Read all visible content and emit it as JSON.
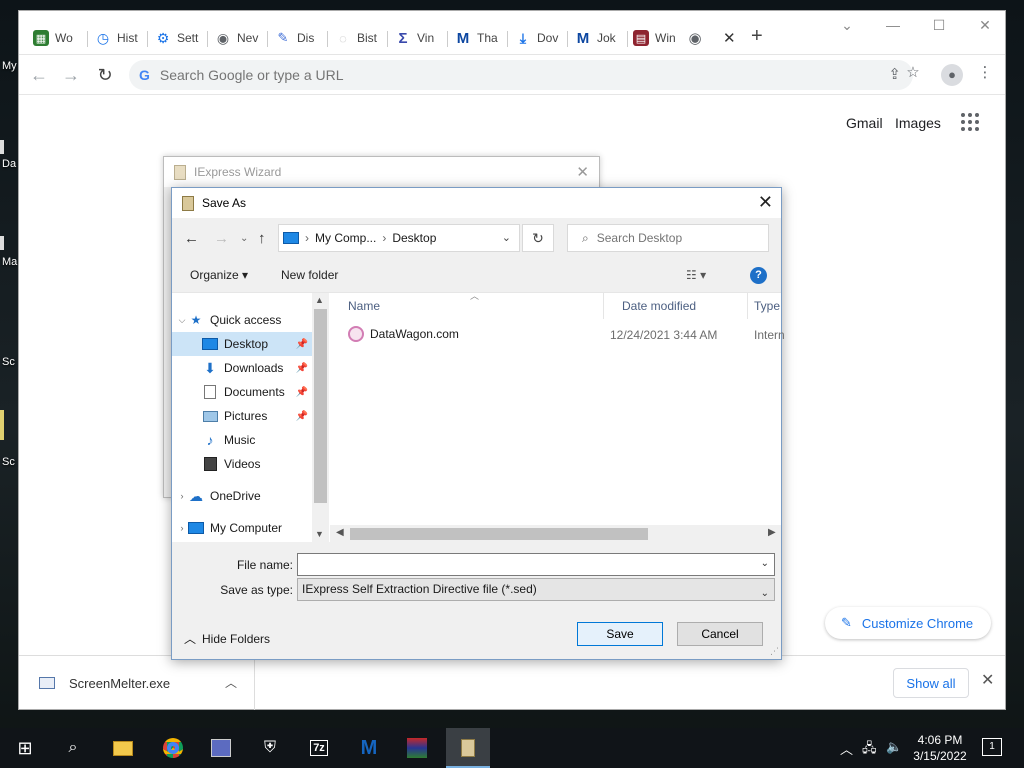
{
  "desktop": {
    "labels": [
      "My",
      "Da",
      "Ma",
      "Sc",
      "Sc"
    ]
  },
  "browser": {
    "tabs": [
      {
        "label": "Wo",
        "icon": "grid-icon",
        "color": "#2e7d32"
      },
      {
        "label": "Hist",
        "icon": "history-icon",
        "color": "#1a73e8"
      },
      {
        "label": "Sett",
        "icon": "gear-icon",
        "color": "#1a73e8"
      },
      {
        "label": "Nev",
        "icon": "chrome-icon",
        "color": "#5f6368"
      },
      {
        "label": "Dis",
        "icon": "pen-icon",
        "color": "#3b6bd6"
      },
      {
        "label": "Bist",
        "icon": "blank-icon",
        "color": "#bbbbbb"
      },
      {
        "label": "Vin",
        "icon": "sigma-icon",
        "color": "#3949ab"
      },
      {
        "label": "Tha",
        "icon": "malwarebytes-icon",
        "color": "#0d47a1"
      },
      {
        "label": "Dov",
        "icon": "download-icon",
        "color": "#1a73e8"
      },
      {
        "label": "Jok",
        "icon": "malwarebytes-icon",
        "color": "#0d47a1"
      },
      {
        "label": "Win",
        "icon": "winrar-icon",
        "color": "#8e2430"
      },
      {
        "label": "",
        "icon": "chrome-icon",
        "color": "#5f6368"
      }
    ],
    "omnibox_placeholder": "Search Google or type a URL",
    "ntp": {
      "gmail": "Gmail",
      "images": "Images",
      "customize": "Customize Chrome"
    },
    "download": {
      "filename": "ScreenMelter.exe",
      "show_all": "Show all"
    }
  },
  "iexpress": {
    "title": "IExpress Wizard"
  },
  "save_as": {
    "title": "Save As",
    "breadcrumb": [
      "My Comp...",
      "Desktop"
    ],
    "search_placeholder": "Search Desktop",
    "organize": "Organize",
    "new_folder": "New folder",
    "nav": [
      {
        "label": "Quick access",
        "icon": "star-icon",
        "level": 0,
        "expanded": true
      },
      {
        "label": "Desktop",
        "icon": "desktop-icon",
        "level": 1,
        "pinned": true,
        "selected": true
      },
      {
        "label": "Downloads",
        "icon": "download-arrow-icon",
        "level": 1,
        "pinned": true
      },
      {
        "label": "Documents",
        "icon": "document-icon",
        "level": 1,
        "pinned": true
      },
      {
        "label": "Pictures",
        "icon": "pictures-icon",
        "level": 1,
        "pinned": true
      },
      {
        "label": "Music",
        "icon": "music-icon",
        "level": 1
      },
      {
        "label": "Videos",
        "icon": "video-icon",
        "level": 1
      },
      {
        "label": "OneDrive",
        "icon": "cloud-icon",
        "level": 0
      },
      {
        "label": "My Computer",
        "icon": "computer-icon",
        "level": 0
      }
    ],
    "columns": {
      "name": "Name",
      "date": "Date modified",
      "type": "Type"
    },
    "files": [
      {
        "name": "DataWagon.com",
        "date": "12/24/2021 3:44 AM",
        "type": "Intern"
      }
    ],
    "file_name_label": "File name:",
    "file_name_value": "",
    "save_type_label": "Save as type:",
    "save_type_value": "IExpress Self Extraction Directive file (*.sed)",
    "hide_folders": "Hide Folders",
    "save": "Save",
    "cancel": "Cancel"
  },
  "taskbar": {
    "time": "4:06 PM",
    "date": "3/15/2022",
    "notifications": "1"
  }
}
